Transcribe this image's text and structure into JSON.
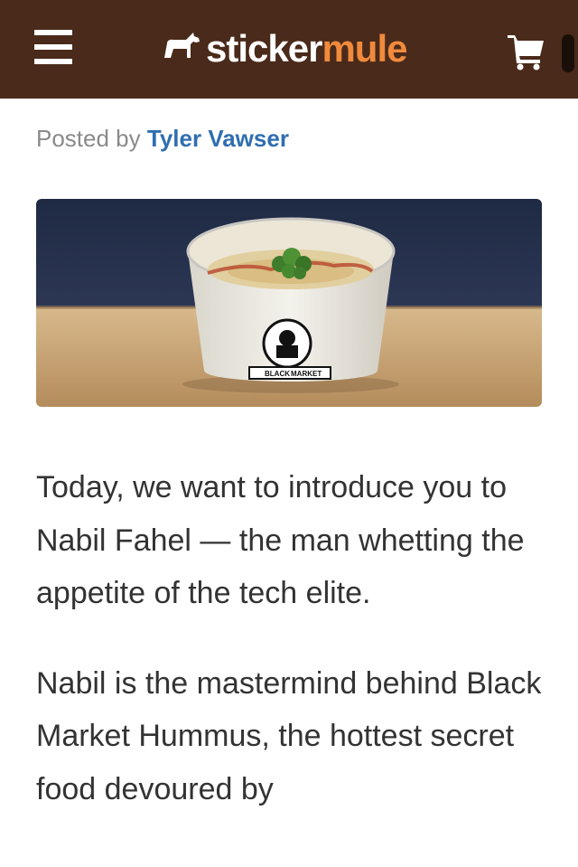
{
  "header": {
    "brand_part1": "sticker",
    "brand_part2": "mule",
    "brand_color": "#f08a3c",
    "bar_color": "#4a2a1a",
    "icons": [
      "menu-icon",
      "mule-logo-icon",
      "cart-icon"
    ]
  },
  "byline": {
    "prefix": "Posted by",
    "author": "Tyler Vawser",
    "author_color": "#2f6fb0"
  },
  "hero": {
    "label_left": "BLACK",
    "label_right": "MARKET"
  },
  "article": {
    "paragraphs": [
      "Today, we want to introduce you to Nabil Fahel — the man whetting the appetite of the tech elite.",
      "Nabil is the mastermind behind Black Market Hummus, the hottest secret food devoured by"
    ]
  }
}
